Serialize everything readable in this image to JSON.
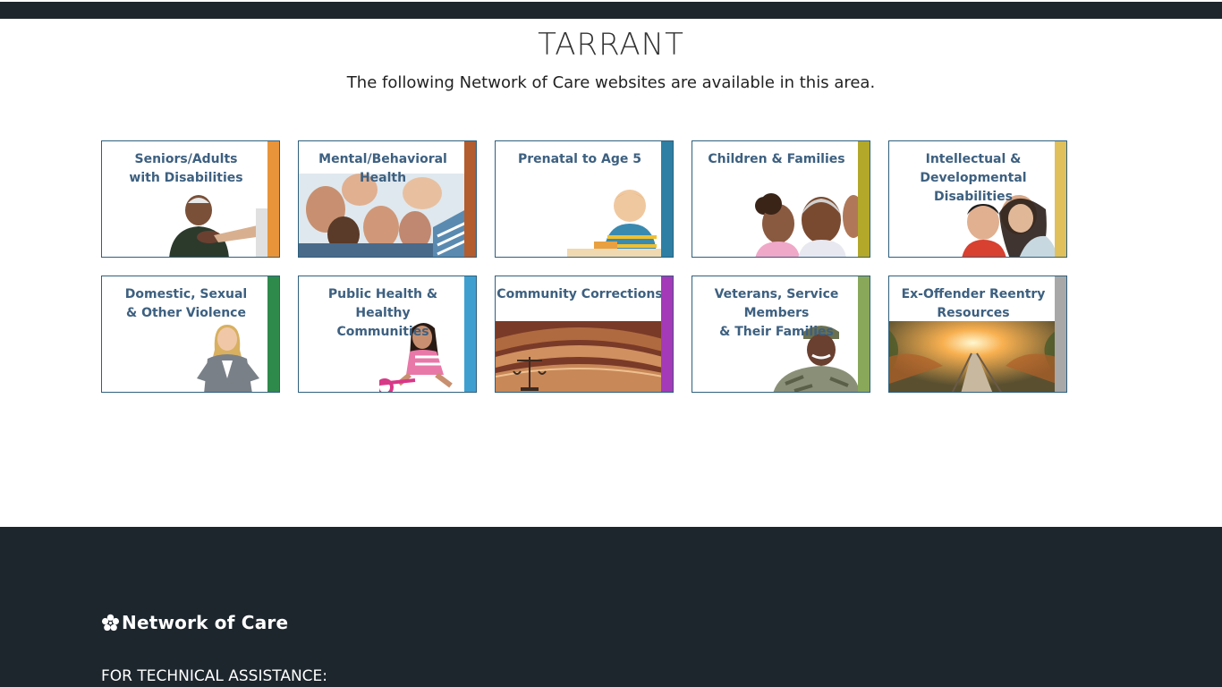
{
  "header": {
    "title": "TARRANT",
    "subtitle": "The following Network of Care websites are available in this area."
  },
  "cards": [
    {
      "line1": "Seniors/Adults",
      "line2": "with Disabilities",
      "stripe": "#e8943a",
      "icon": "seniors-photo"
    },
    {
      "line1": "Mental/Behavioral Health",
      "line2": "",
      "stripe": "#b35c2e",
      "icon": "group-smiling-photo"
    },
    {
      "line1": "Prenatal to Age 5",
      "line2": "",
      "stripe": "#2e7fa3",
      "icon": "toddler-photo"
    },
    {
      "line1": "Children & Families",
      "line2": "",
      "stripe": "#b3a82a",
      "icon": "family-photo"
    },
    {
      "line1": "Intellectual &",
      "line2": "Developmental Disabilities",
      "stripe": "#e0c05a",
      "icon": "mother-child-photo"
    },
    {
      "line1": "Domestic, Sexual",
      "line2": "& Other Violence",
      "stripe": "#2e8a4a",
      "icon": "woman-standing-photo"
    },
    {
      "line1": "Public Health & Healthy",
      "line2": "Communities",
      "stripe": "#3fa0d0",
      "icon": "girl-bike-photo"
    },
    {
      "line1": "Community Corrections",
      "line2": "",
      "stripe": "#a43ab8",
      "icon": "courtroom-photo",
      "prefix_icon": ""
    },
    {
      "line1": "Veterans, Service Members",
      "line2": "& Their Families",
      "stripe": "#8aa85a",
      "icon": "soldier-photo"
    },
    {
      "line1": "Ex-Offender Reentry",
      "line2": "Resources",
      "stripe": "#a8a8a8",
      "icon": "bridge-sunset-photo"
    }
  ],
  "footer": {
    "logo_text": "Network of Care",
    "tech_label": "FOR TECHNICAL ASSISTANCE:"
  }
}
